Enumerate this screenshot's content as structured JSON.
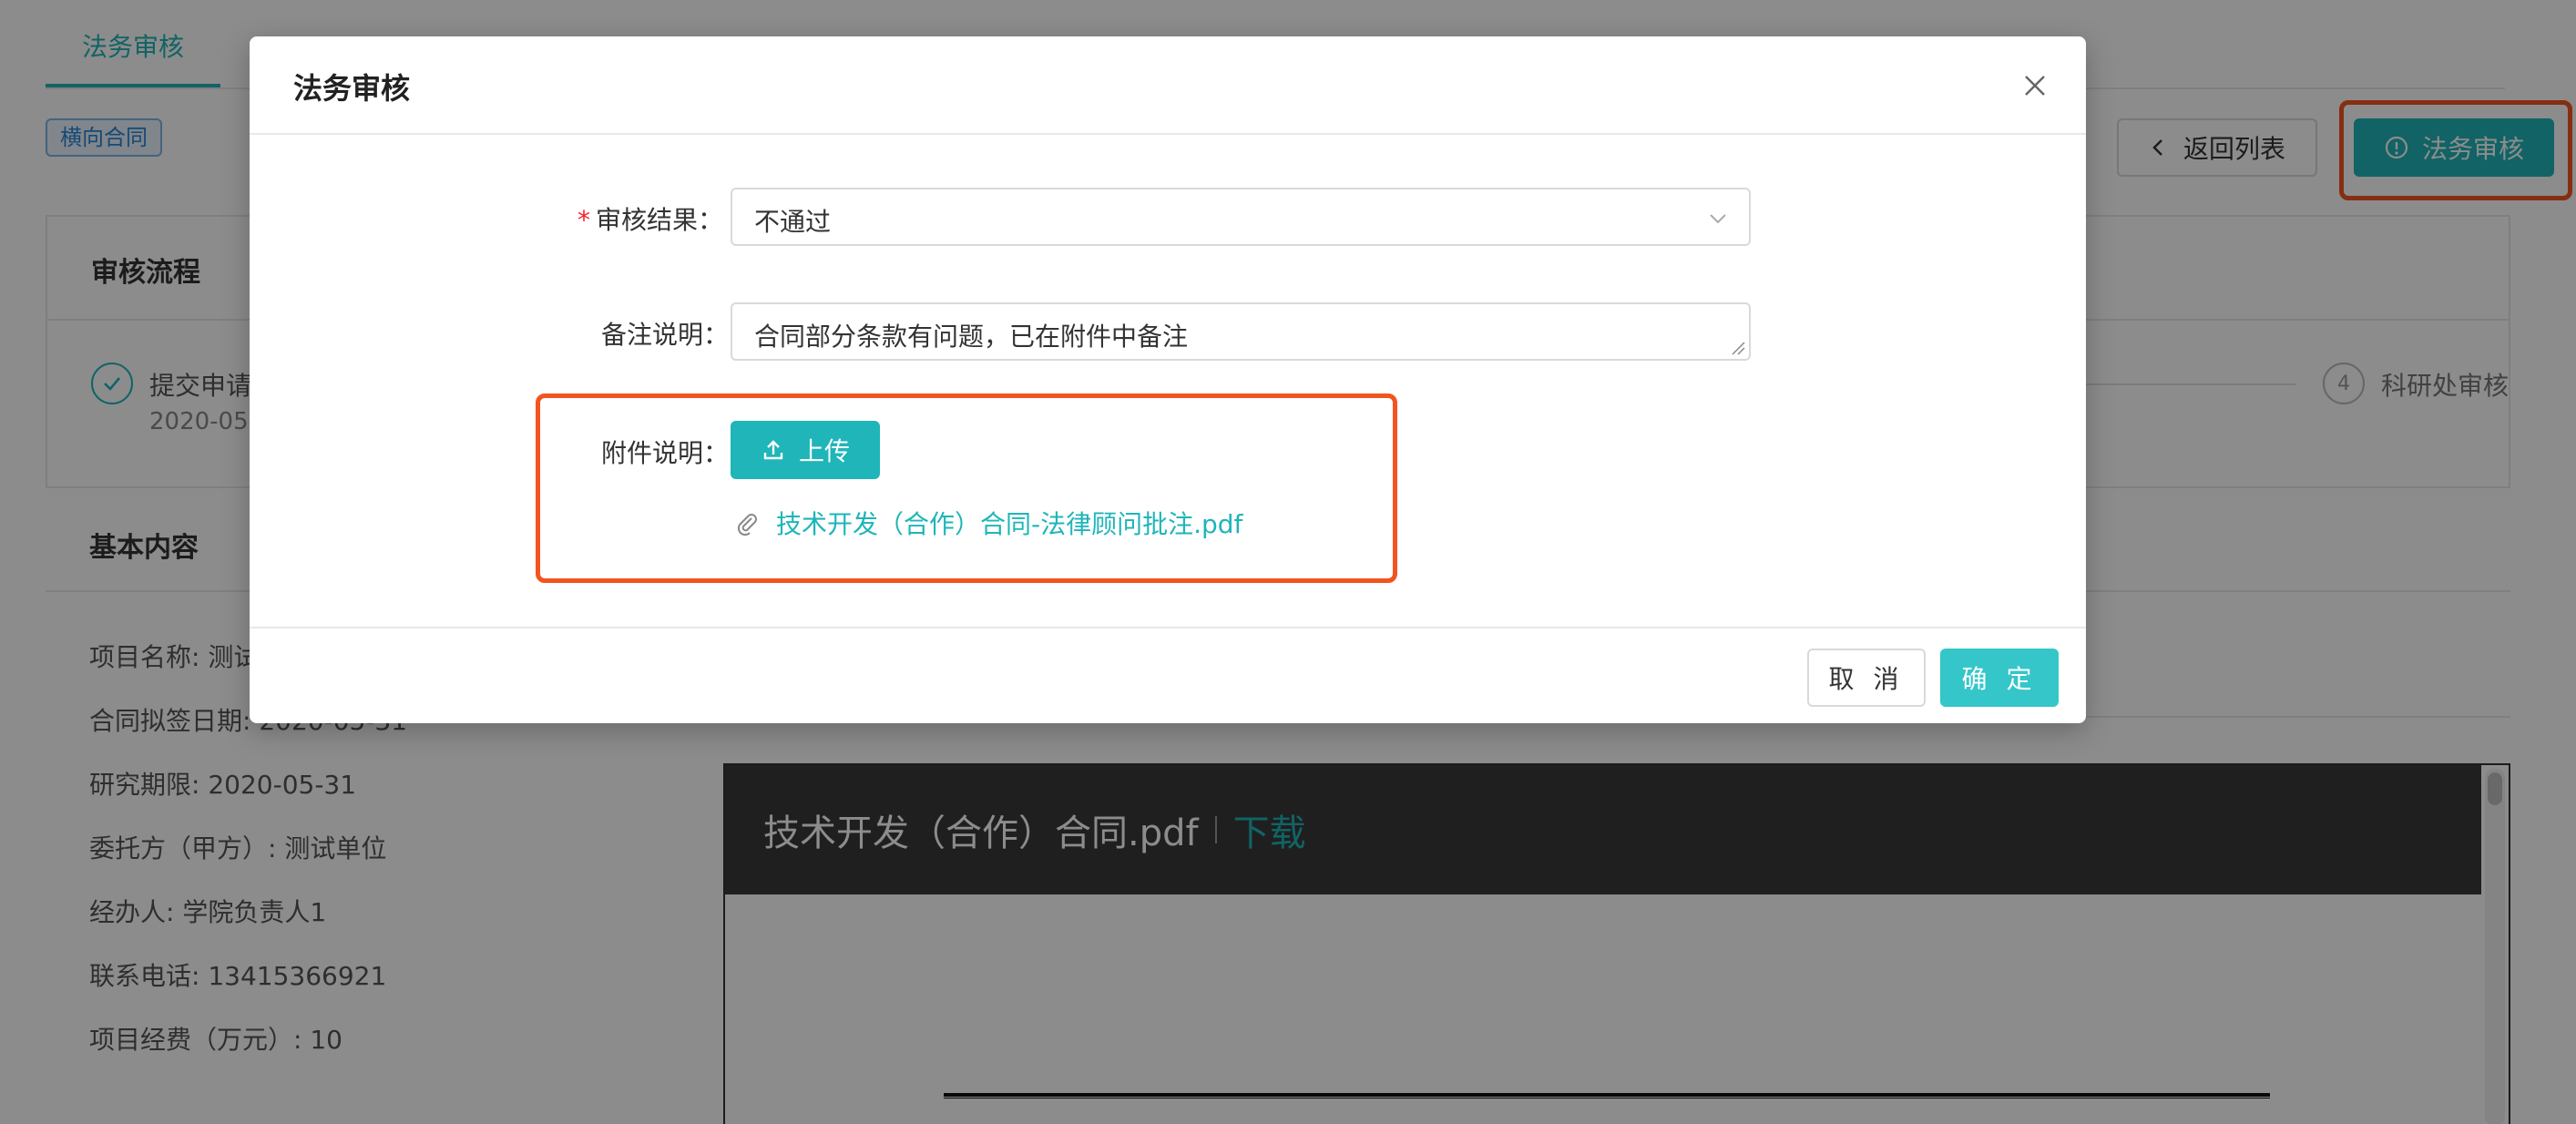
{
  "page": {
    "tab_active": "法务审核",
    "contract_tag": "横向合同",
    "back_button": "返回列表",
    "legal_review_button": "法务审核",
    "flow_section_title": "审核流程",
    "steps": [
      {
        "label": "提交申请",
        "date": "2020-05-",
        "done": true
      },
      {
        "number": "4",
        "label": "科研处审核"
      }
    ],
    "basic_section_title": "基本内容",
    "info": [
      "项目名称: 测试",
      "合同拟签日期: 2020-05-31",
      "研究期限: 2020-05-31",
      "委托方（甲方）: 测试单位",
      "经办人: 学院负责人1",
      "联系电话: 13415366921",
      "项目经费（万元）: 10"
    ],
    "pdf": {
      "filename": "技术开发（合作）合同.pdf",
      "download": "下载"
    }
  },
  "modal": {
    "title": "法务审核",
    "result_label": "审核结果：",
    "result_value": "不通过",
    "remark_label": "备注说明：",
    "remark_value": "合同部分条款有问题，已在附件中备注",
    "attachment_label": "附件说明：",
    "upload_button": "上传",
    "attachment_file": "技术开发（合作）合同-法律顾问批注.pdf",
    "cancel_button": "取 消",
    "ok_button": "确 定"
  },
  "colors": {
    "accent": "#1fb5b9",
    "highlight": "#f2541f",
    "required": "#f5222d"
  },
  "icons": [
    "close-icon",
    "chevron-down-icon",
    "upload-icon",
    "paperclip-icon",
    "chevron-left-icon",
    "info-circle-icon",
    "check-icon"
  ]
}
